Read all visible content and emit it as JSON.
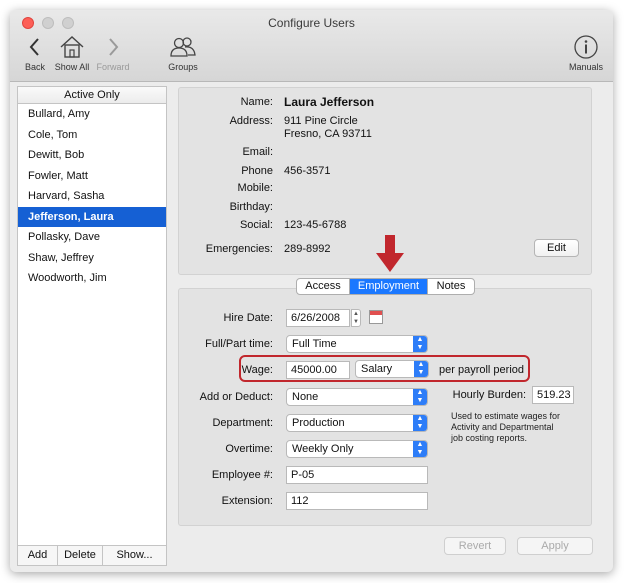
{
  "window": {
    "title": "Configure Users"
  },
  "toolbar": {
    "back": "Back",
    "show_all": "Show All",
    "forward": "Forward",
    "groups": "Groups",
    "manuals": "Manuals"
  },
  "sidebar": {
    "header": "Active Only",
    "items": [
      {
        "label": "Bullard, Amy"
      },
      {
        "label": "Cole, Tom"
      },
      {
        "label": "Dewitt, Bob"
      },
      {
        "label": "Fowler, Matt"
      },
      {
        "label": "Harvard, Sasha"
      },
      {
        "label": "Jefferson, Laura"
      },
      {
        "label": "Pollasky, Dave"
      },
      {
        "label": "Shaw, Jeffrey"
      },
      {
        "label": "Woodworth, Jim"
      }
    ],
    "selected_index": 5,
    "footer": {
      "add": "Add",
      "delete": "Delete",
      "show": "Show..."
    }
  },
  "info": {
    "name_label": "Name:",
    "name": "Laura Jefferson",
    "address_label": "Address:",
    "address_line1": "911 Pine Circle",
    "address_line2": "Fresno, CA 93711",
    "email_label": "Email:",
    "phone_label": "Phone",
    "phone": "456-3571",
    "mobile_label": "Mobile:",
    "birthday_label": "Birthday:",
    "social_label": "Social:",
    "social": "123-45-6788",
    "emergencies_label": "Emergencies:",
    "emergencies": "289-8992",
    "edit_button": "Edit"
  },
  "tabs": [
    {
      "label": "Access"
    },
    {
      "label": "Employment"
    },
    {
      "label": "Notes"
    }
  ],
  "employment": {
    "hire_date_label": "Hire Date:",
    "hire_date": "6/26/2008",
    "full_part_label": "Full/Part time:",
    "full_part": "Full Time",
    "wage_label": "Wage:",
    "wage": "45000.00",
    "wage_type": "Salary",
    "wage_suffix": "per payroll period",
    "add_deduct_label": "Add or Deduct:",
    "add_deduct": "None",
    "hourly_burden_label": "Hourly Burden:",
    "hourly_burden": "519.23",
    "hourly_burden_note_1": "Used to estimate wages for",
    "hourly_burden_note_2": "Activity and Departmental",
    "hourly_burden_note_3": "job costing reports.",
    "department_label": "Department:",
    "department": "Production",
    "overtime_label": "Overtime:",
    "overtime": "Weekly Only",
    "employee_no_label": "Employee #:",
    "employee_no": "P-05",
    "extension_label": "Extension:",
    "extension": "112"
  },
  "actions": {
    "revert": "Revert",
    "apply": "Apply"
  },
  "colors": {
    "selection": "#1560d4",
    "accent": "#1b78ff",
    "highlight": "#c1272d"
  }
}
